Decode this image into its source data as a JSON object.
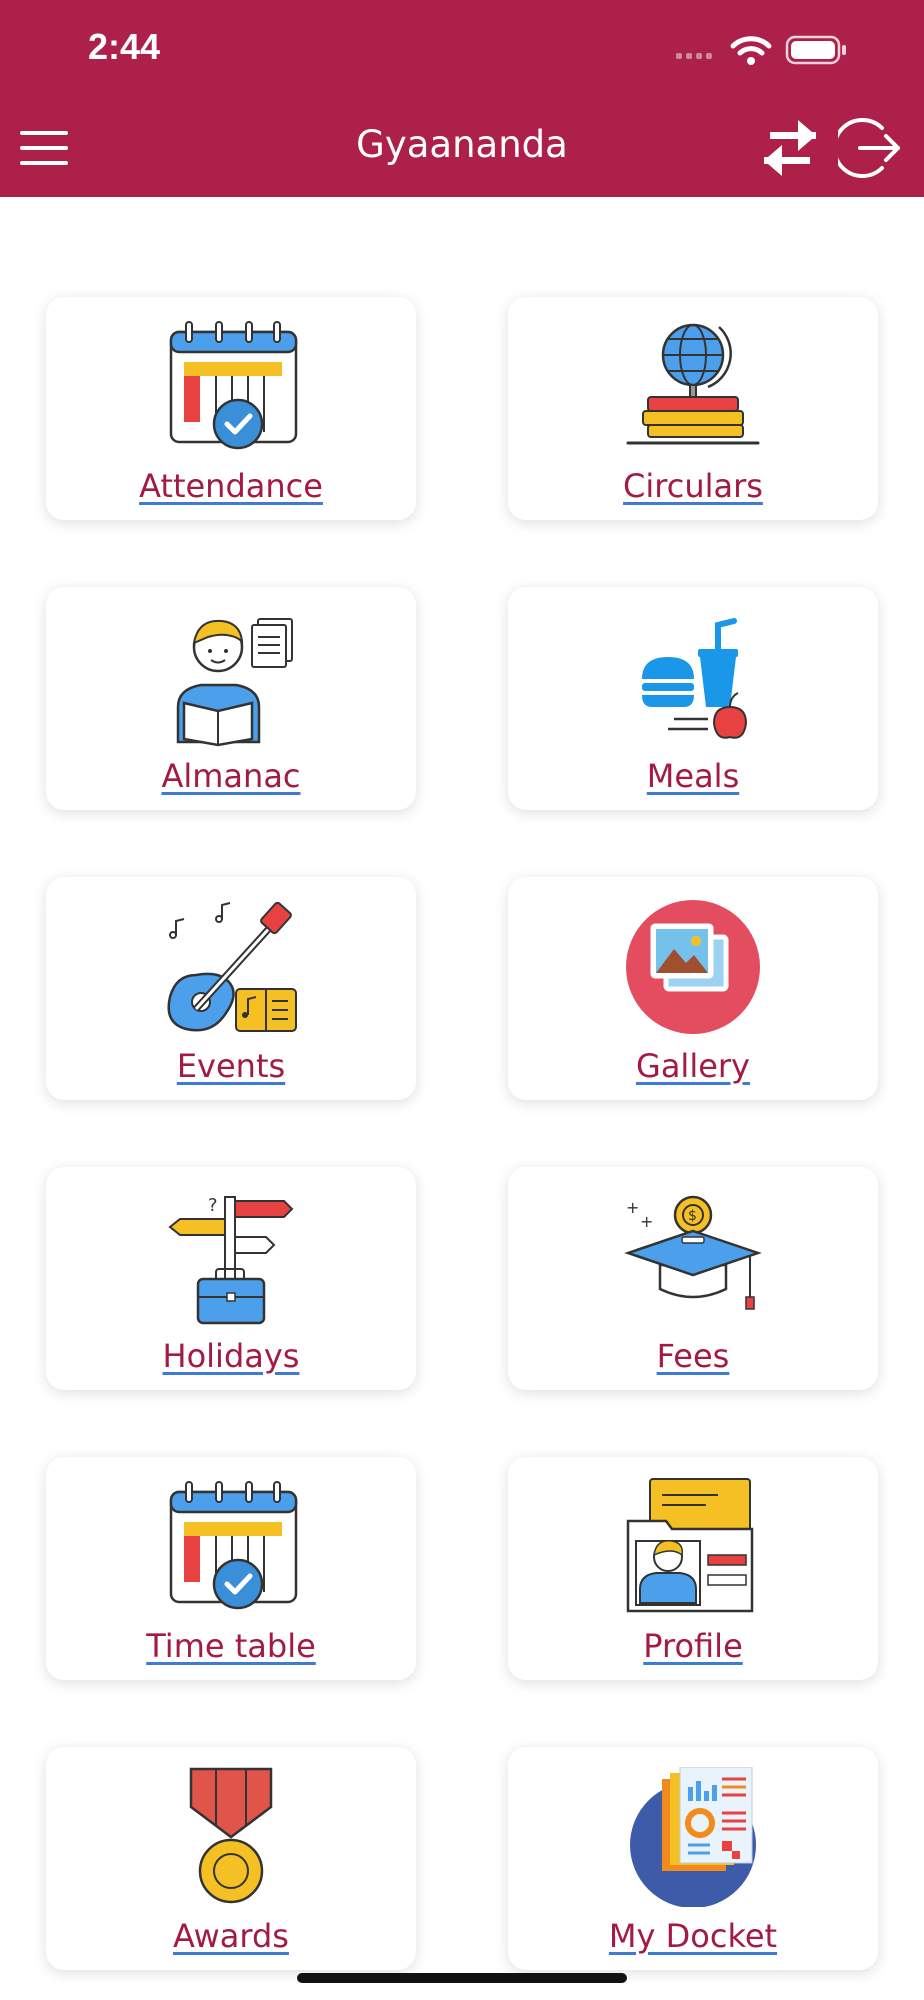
{
  "status_bar": {
    "time": "2:44"
  },
  "header": {
    "title": "Gyaananda",
    "background": "#ac2049"
  },
  "tiles": [
    {
      "label": "Attendance",
      "icon": "calendar-check-icon"
    },
    {
      "label": "Circulars",
      "icon": "globe-books-icon"
    },
    {
      "label": "Almanac",
      "icon": "student-reading-icon"
    },
    {
      "label": "Meals",
      "icon": "meal-icon"
    },
    {
      "label": "Events",
      "icon": "guitar-music-icon"
    },
    {
      "label": "Gallery",
      "icon": "gallery-photos-icon"
    },
    {
      "label": "Holidays",
      "icon": "signpost-suitcase-icon"
    },
    {
      "label": "Fees",
      "icon": "graduation-cap-coin-icon"
    },
    {
      "label": "Time table",
      "icon": "calendar-check-icon"
    },
    {
      "label": "Profile",
      "icon": "id-card-icon"
    },
    {
      "label": "Awards",
      "icon": "medal-icon"
    },
    {
      "label": "My Docket",
      "icon": "report-docs-icon"
    }
  ],
  "colors": {
    "label_text": "#a31a42",
    "underline": "#3f7bd6",
    "accent": "#ac2049"
  }
}
